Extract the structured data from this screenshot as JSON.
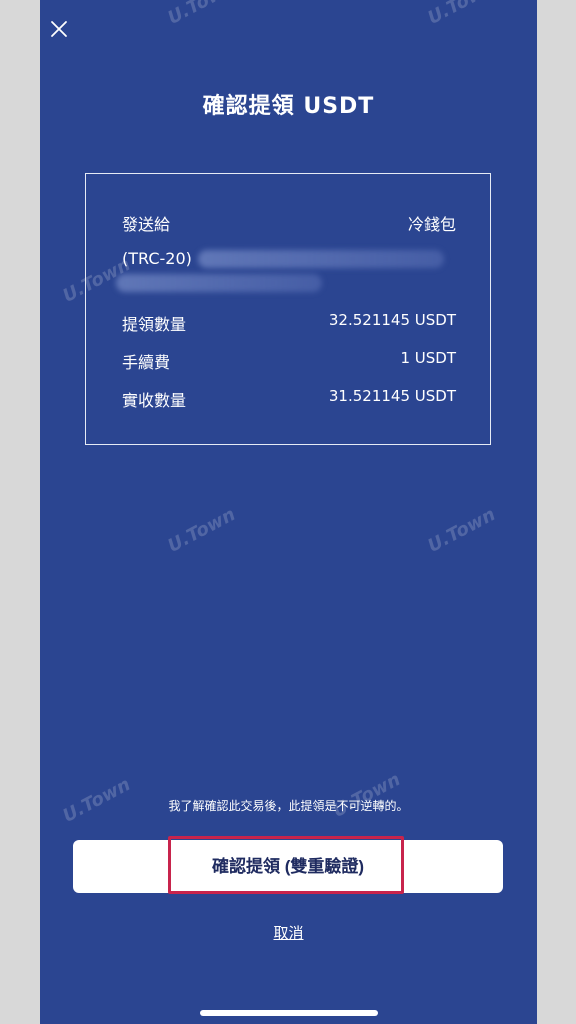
{
  "header": {
    "close_icon": "close-icon",
    "title": "確認提領 USDT"
  },
  "summary": {
    "send_to_label": "發送給",
    "send_to_value": "冷錢包",
    "network": "(TRC-20)",
    "rows": [
      {
        "label": "提領數量",
        "value": "32.521145 USDT"
      },
      {
        "label": "手續費",
        "value": "1 USDT"
      },
      {
        "label": "實收數量",
        "value": "31.521145 USDT"
      }
    ]
  },
  "watermark": "U.Town",
  "footer": {
    "notice": "我了解確認此交易後，此提領是不可逆轉的。",
    "confirm_label": "確認提領 (雙重驗證)",
    "cancel_label": "取消"
  },
  "colors": {
    "background": "#2b4591",
    "highlight_border": "#c8244c"
  }
}
